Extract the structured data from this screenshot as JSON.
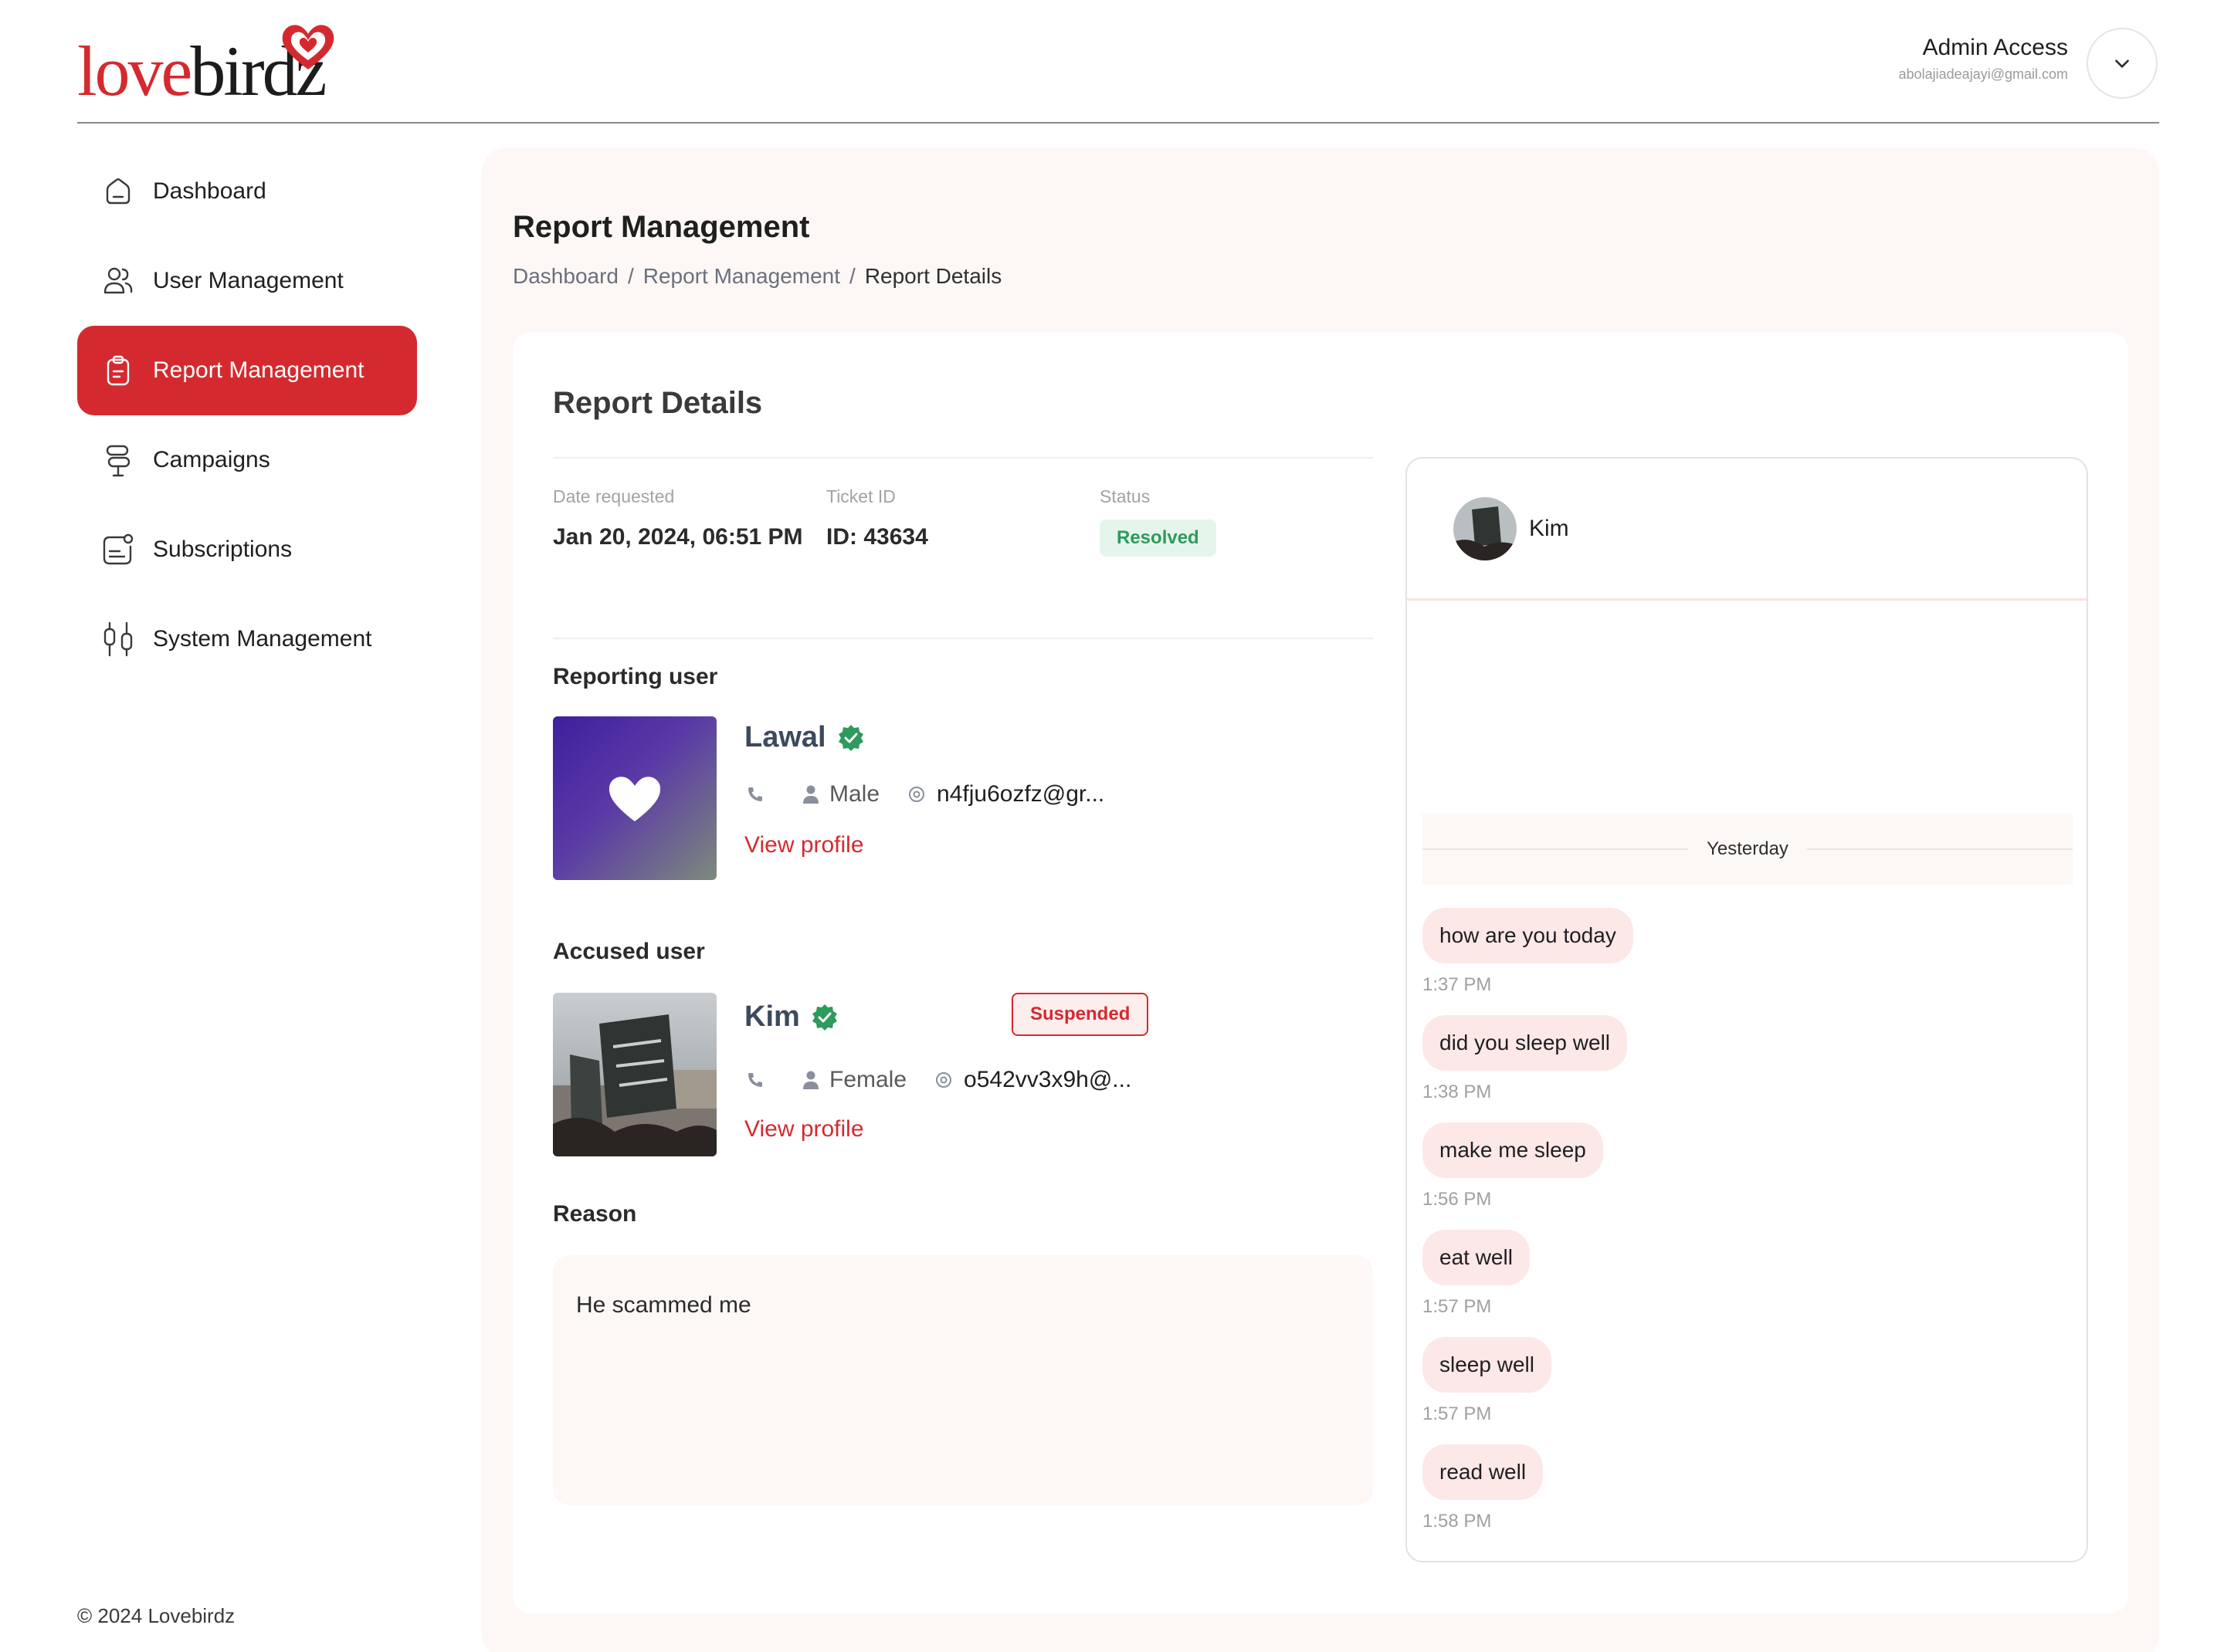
{
  "brand": {
    "name_love": "love",
    "name_birdz": "birdz",
    "accent": "#d42a2f"
  },
  "admin": {
    "name": "Admin Access",
    "email": "abolajiadeajayi@gmail.com",
    "toggle_icon": "chevron-down-icon"
  },
  "sidebar": {
    "items": [
      {
        "label": "Dashboard",
        "icon": "home-icon",
        "active": false
      },
      {
        "label": "User Management",
        "icon": "users-icon",
        "active": false
      },
      {
        "label": "Report Management",
        "icon": "clipboard-icon",
        "active": true
      },
      {
        "label": "Campaigns",
        "icon": "signpost-icon",
        "active": false
      },
      {
        "label": "Subscriptions",
        "icon": "subscription-icon",
        "active": false
      },
      {
        "label": "System Management",
        "icon": "sliders-icon",
        "active": false
      }
    ],
    "footer": "© 2024 Lovebirdz"
  },
  "page": {
    "title": "Report Management",
    "breadcrumb": [
      "Dashboard",
      "Report Management",
      "Report Details"
    ],
    "separator": "/"
  },
  "report": {
    "title": "Report Details",
    "date_label": "Date requested",
    "date_value": "Jan 20, 2024, 06:51 PM",
    "ticket_label": "Ticket ID",
    "ticket_value": "ID: 43634",
    "status_label": "Status",
    "status_value": "Resolved",
    "status_color": "#2e9a5c"
  },
  "reporting_user": {
    "section": "Reporting user",
    "name": "Lawal",
    "gender": "Male",
    "email": "n4fju6ozfz@gr...",
    "view_link": "View profile"
  },
  "accused_user": {
    "section": "Accused user",
    "name": "Kim",
    "gender": "Female",
    "email": "o542vv3x9h@...",
    "badge": "Suspended",
    "view_link": "View profile"
  },
  "reason": {
    "label": "Reason",
    "text": "He scammed me"
  },
  "chat": {
    "contact": "Kim",
    "day": "Yesterday",
    "messages": [
      {
        "text": "how are you today",
        "time": "1:37 PM"
      },
      {
        "text": "did you sleep well",
        "time": "1:38 PM"
      },
      {
        "text": "make me sleep",
        "time": "1:56 PM"
      },
      {
        "text": "eat well",
        "time": "1:57 PM"
      },
      {
        "text": "sleep well",
        "time": "1:57 PM"
      },
      {
        "text": "read well",
        "time": "1:58 PM"
      }
    ]
  }
}
